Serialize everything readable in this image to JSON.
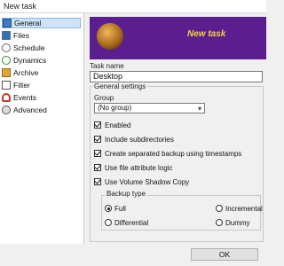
{
  "window": {
    "title": "New task"
  },
  "sidebar": {
    "items": [
      {
        "label": "General",
        "icon": "general-icon"
      },
      {
        "label": "Files",
        "icon": "files-icon"
      },
      {
        "label": "Schedule",
        "icon": "schedule-icon"
      },
      {
        "label": "Dynamics",
        "icon": "dynamics-icon"
      },
      {
        "label": "Archive",
        "icon": "archive-icon"
      },
      {
        "label": "Filter",
        "icon": "filter-icon"
      },
      {
        "label": "Events",
        "icon": "events-icon"
      },
      {
        "label": "Advanced",
        "icon": "advanced-icon"
      }
    ],
    "selected": "General"
  },
  "banner": {
    "title": "New task",
    "background_color": "#5b1e8f",
    "title_color": "#f5d442"
  },
  "task_name": {
    "label": "Task name",
    "value": "Desktop"
  },
  "general_settings": {
    "title": "General settings",
    "group_label": "Group",
    "group_value": "(No group)",
    "checkboxes": [
      {
        "label": "Enabled",
        "checked": true
      },
      {
        "label": "Include subdirectories",
        "checked": true
      },
      {
        "label": "Create separated backup using timestamps",
        "checked": true
      },
      {
        "label": "Use file attribute logic",
        "checked": true
      },
      {
        "label": "Use Volume Shadow Copy",
        "checked": true
      }
    ],
    "backup_type": {
      "title": "Backup type",
      "options": [
        {
          "label": "Full",
          "selected": true
        },
        {
          "label": "Incremental",
          "selected": false
        },
        {
          "label": "Differential",
          "selected": false
        },
        {
          "label": "Dummy",
          "selected": false
        }
      ]
    }
  },
  "footer": {
    "ok_label": "OK"
  }
}
